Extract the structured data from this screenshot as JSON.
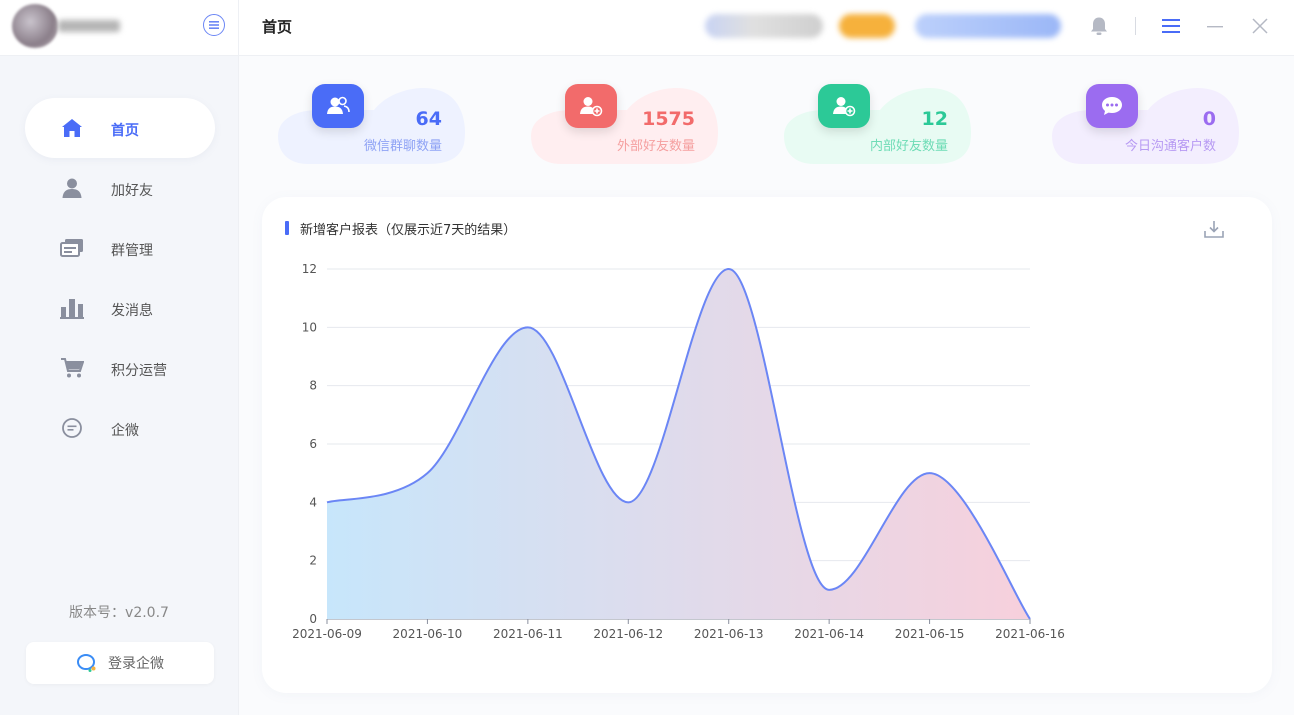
{
  "sidebar": {
    "nav": [
      {
        "label": "首页",
        "icon": "home-icon",
        "active": true
      },
      {
        "label": "加好友",
        "icon": "user-icon",
        "active": false
      },
      {
        "label": "群管理",
        "icon": "group-manage-icon",
        "active": false
      },
      {
        "label": "发消息",
        "icon": "bar-chart-icon",
        "active": false
      },
      {
        "label": "积分运营",
        "icon": "cart-icon",
        "active": false
      },
      {
        "label": "企微",
        "icon": "chat-bubble-icon",
        "active": false
      }
    ],
    "version": "版本号：v2.0.7",
    "login_label": "登录企微"
  },
  "header": {
    "title": "首页"
  },
  "stats": [
    {
      "value": "64",
      "label": "微信群聊数量",
      "icon": "group-icon",
      "color": "#4a6cf7",
      "bg": "#eef2ff"
    },
    {
      "value": "1575",
      "label": "外部好友数量",
      "icon": "add-user-icon",
      "color": "#f26b6b",
      "bg": "#ffeef0"
    },
    {
      "value": "12",
      "label": "内部好友数量",
      "icon": "add-user-icon",
      "color": "#2cc997",
      "bg": "#e8fbf3"
    },
    {
      "value": "0",
      "label": "今日沟通客户数",
      "icon": "chat-icon",
      "color": "#9b6cf0",
      "bg": "#f3eefe"
    }
  ],
  "chart": {
    "title": "新增客户报表（仅展示近7天的结果）"
  },
  "chart_data": {
    "type": "area",
    "title": "新增客户报表（仅展示近7天的结果）",
    "x": [
      "2021-06-09",
      "2021-06-10",
      "2021-06-11",
      "2021-06-12",
      "2021-06-13",
      "2021-06-14",
      "2021-06-15",
      "2021-06-16"
    ],
    "values": [
      4,
      5,
      10,
      4,
      12,
      1,
      5,
      0
    ],
    "yticks": [
      "0",
      "2",
      "4",
      "6",
      "8",
      "10",
      "12"
    ],
    "ylim": [
      0,
      12
    ],
    "grid": true,
    "line_color": "#6b86f5",
    "fill_gradient": [
      "#c7e6fb",
      "#f7d0dc"
    ]
  }
}
